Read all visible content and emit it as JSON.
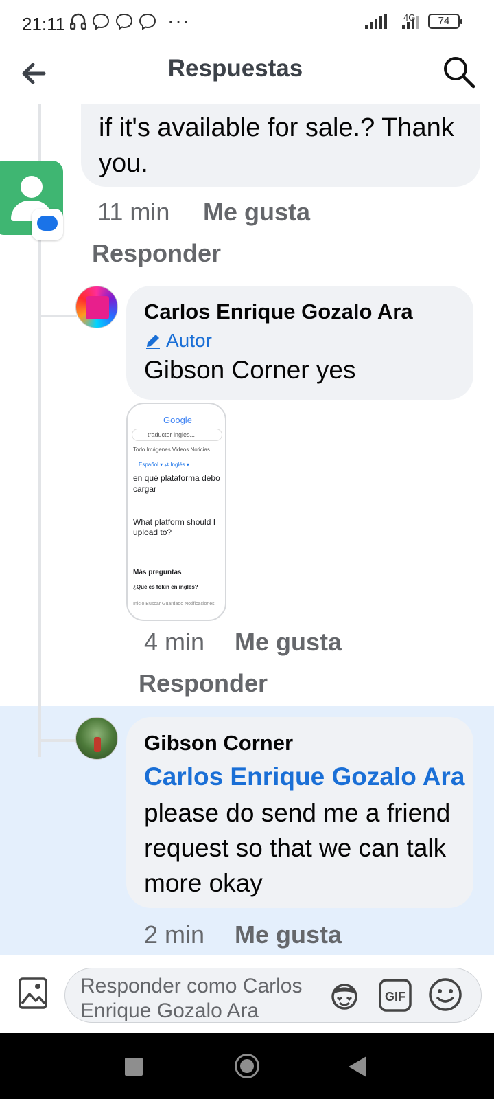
{
  "status_bar": {
    "time": "21:11",
    "network": "4G",
    "battery": "74",
    "more": "···",
    "icons": [
      "headphones-icon",
      "messenger-icon",
      "messenger-icon",
      "messenger-icon",
      "signal-icon",
      "signal-4g-icon",
      "battery-icon"
    ]
  },
  "header": {
    "title": "Respuestas",
    "icons": [
      "back-arrow-icon",
      "search-icon"
    ]
  },
  "comments": [
    {
      "text": "if it's available for sale.? Thank you.",
      "time": "11 min",
      "like_label": "Me gusta",
      "reply_label": "Responder"
    },
    {
      "author": "Carlos Enrique Gozalo Ara",
      "badge": "Autor",
      "text": "Gibson Corner yes",
      "time": "4 min",
      "like_label": "Me gusta",
      "reply_label": "Responder",
      "attachment": {
        "logo": "Google",
        "search": "traductor ingles...",
        "tabs": "Todo  Imágenes  Videos  Noticias",
        "languages": "Español ▾   ⇄   Inglés ▾",
        "source": "en qué plataforma debo cargar",
        "translation": "What platform should I upload to?",
        "more": "Más preguntas",
        "question": "¿Qué es fokin en inglés?",
        "nav": "Inicio  Buscar  Guardado  Notificaciones"
      }
    },
    {
      "author": "Gibson Corner",
      "mention": "Carlos Enrique Gozalo Ara",
      "text": "please do send me a friend request so that we can talk more okay",
      "time": "2 min",
      "like_label": "Me gusta"
    }
  ],
  "composer": {
    "placeholder": "Responder como Carlos Enrique Gozalo Ara",
    "gif_label": "GIF",
    "icons": [
      "photo-icon",
      "avatar-sticker-icon",
      "gif-icon",
      "emoji-icon"
    ]
  },
  "colors": {
    "accent": "#1a6fd6",
    "bubble": "#f0f2f5",
    "highlight": "#e4effc",
    "meta": "#65676b"
  }
}
